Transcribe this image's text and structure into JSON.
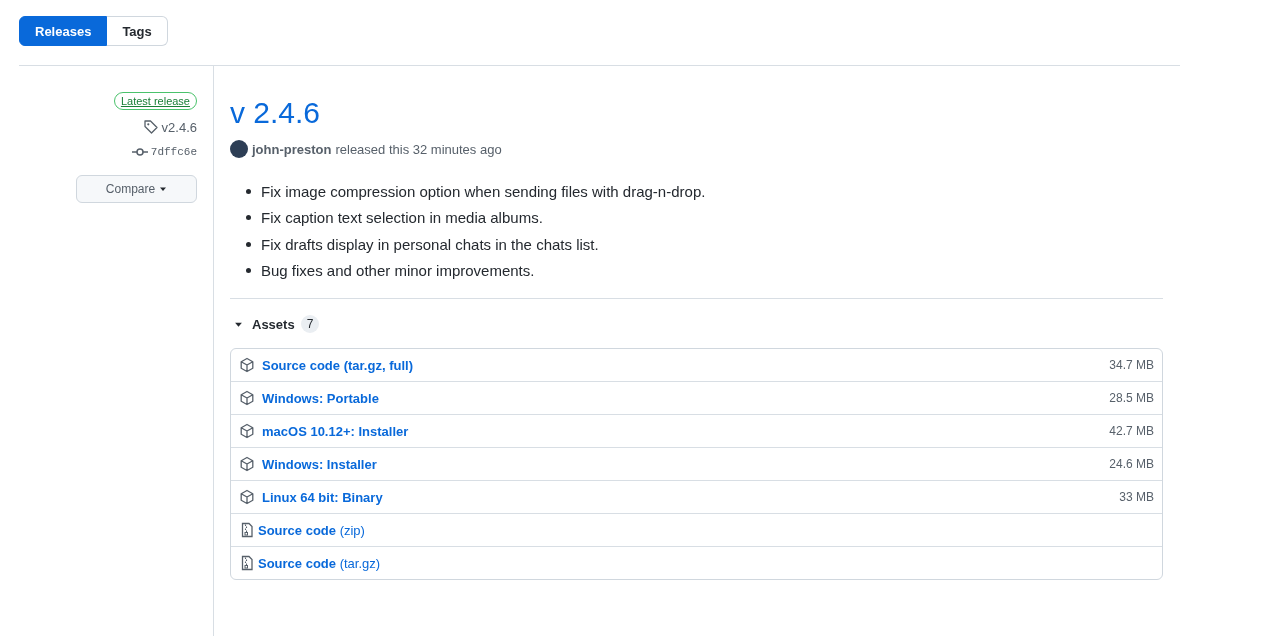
{
  "tabs": [
    {
      "label": "Releases",
      "selected": true
    },
    {
      "label": "Tags",
      "selected": false
    }
  ],
  "sidebar": {
    "badge": "Latest release",
    "tag": "v2.4.6",
    "commit": "7dffc6e",
    "compare": "Compare"
  },
  "release": {
    "title": "v 2.4.6",
    "author": "john-preston",
    "meta": "released this 32 minutes ago",
    "notes": [
      "Fix image compression option when sending files with drag-n-drop.",
      "Fix caption text selection in media albums.",
      "Fix drafts display in personal chats in the chats list.",
      "Bug fixes and other minor improvements."
    ]
  },
  "assets": {
    "label": "Assets",
    "count": "7",
    "expanded": true,
    "items": [
      {
        "kind": "package",
        "name": "Source code (tar.gz, full)",
        "size": "34.7 MB"
      },
      {
        "kind": "package",
        "name": "Windows: Portable",
        "size": "28.5 MB"
      },
      {
        "kind": "package",
        "name": "macOS 10.12+: Installer",
        "size": "42.7 MB"
      },
      {
        "kind": "package",
        "name": "Windows: Installer",
        "size": "24.6 MB"
      },
      {
        "kind": "package",
        "name": "Linux 64 bit: Binary",
        "size": "33 MB"
      },
      {
        "kind": "archive",
        "name": "**Source code** (zip)"
      },
      {
        "kind": "archive",
        "name": "**Source code** (tar.gz)"
      }
    ]
  }
}
